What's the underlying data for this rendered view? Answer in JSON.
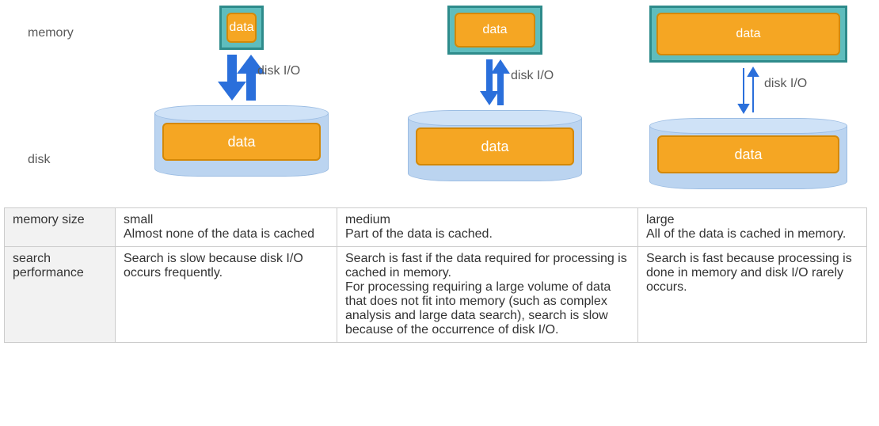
{
  "labels": {
    "memory": "memory",
    "disk": "disk",
    "disk_io": "disk I/O",
    "data": "data"
  },
  "table": {
    "rows": [
      {
        "header": "memory size",
        "cols": [
          "small\nAlmost none of the data is cached",
          "medium\nPart of the data is cached.",
          "large\nAll of the data is cached in memory."
        ]
      },
      {
        "header": "search performance",
        "cols": [
          "Search is slow because disk I/O occurs frequently.",
          "Search is fast if the data required for processing is cached in memory.\nFor processing requiring a large volume of data that does not fit into memory (such as complex analysis and large data search), search is slow because of the occurrence of disk I/O.",
          "Search is fast because processing is done in memory and disk I/O rarely occurs."
        ]
      }
    ]
  }
}
